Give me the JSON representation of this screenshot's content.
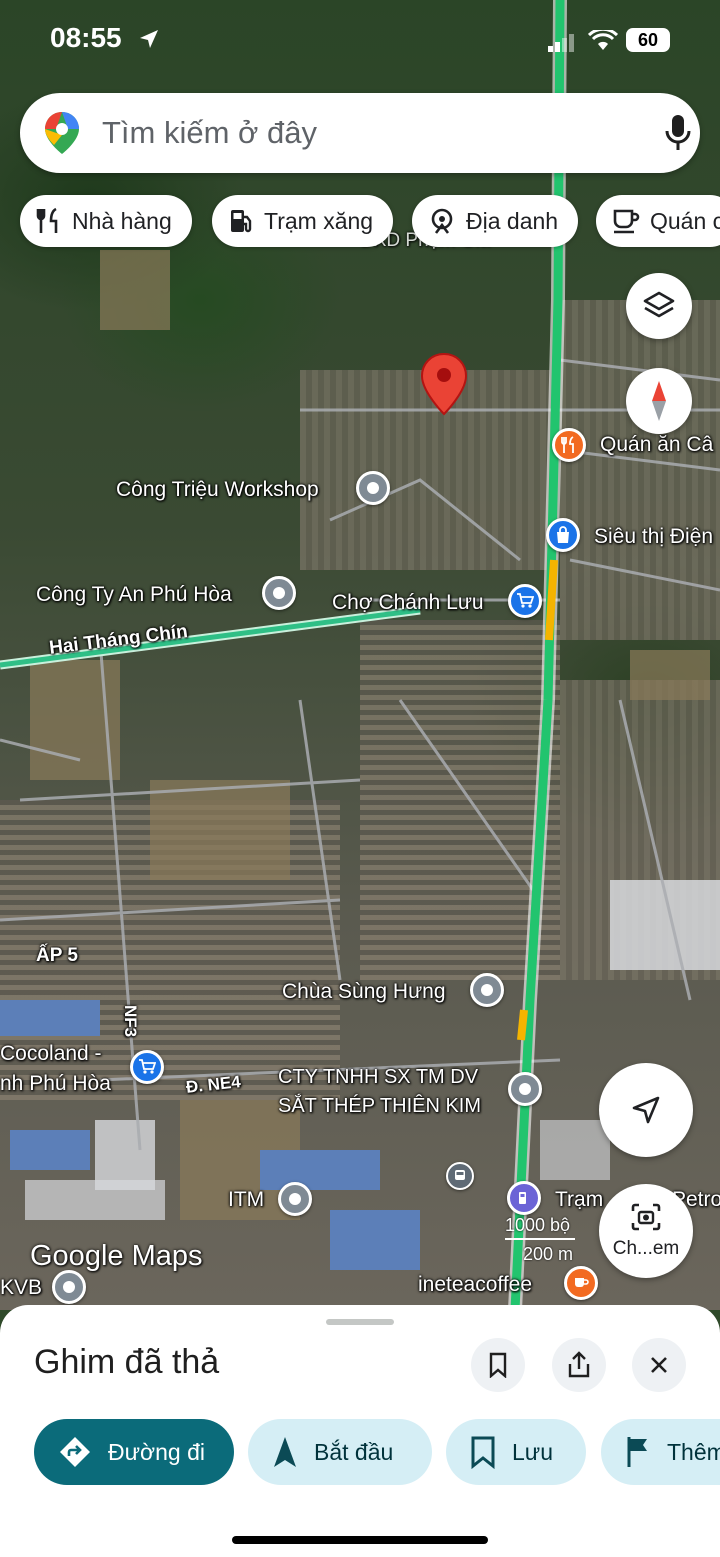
{
  "status": {
    "time": "08:55",
    "battery": "60"
  },
  "search": {
    "placeholder": "Tìm kiếm ở đây"
  },
  "chips": [
    {
      "label": "Nhà hàng",
      "icon": "fork-knife-icon"
    },
    {
      "label": "Trạm xăng",
      "icon": "gas-station-icon"
    },
    {
      "label": "Địa danh",
      "icon": "landmark-icon"
    },
    {
      "label": "Quán c",
      "icon": "coffee-icon"
    }
  ],
  "map": {
    "places": {
      "quan_an": "Quán ăn Câ",
      "sieu_thi": "Siêu thị Điện",
      "cong_trieu": "Công Triệu Workshop",
      "an_phu_hoa": "Công Ty An Phú Hòa",
      "cho_chanh_luu": "Chợ Chánh Lưu",
      "chua": "Chùa Sùng Hưng",
      "cocoland_1": "Cocoland -",
      "cocoland_2": "nh Phú Hòa",
      "thien_kim_1": "CTY TNHH SX TM DV",
      "thien_kim_2": "SẮT THÉP THIÊN KIM",
      "itm": "ITM",
      "tram": "Trạm",
      "petro": "Petro",
      "ineteacoffee": "ineteacoffee",
      "kvb": "KVB",
      "dxd": "DXD Phạm Gia"
    },
    "roads": {
      "hai_thang_chin": "Hai Tháng Chín",
      "ap5": "ẤP 5",
      "nf3": "NF3",
      "ne4": "Đ. NE4"
    },
    "scale": {
      "imperial": "1000 bộ",
      "metric": "200 m"
    },
    "watermark": "Google Maps",
    "camera_label": "Ch...em"
  },
  "sheet": {
    "title": "Ghim đã thả",
    "actions": [
      {
        "label": "Đường đi",
        "icon": "directions-icon"
      },
      {
        "label": "Bắt đầu",
        "icon": "navigation-arrow-icon"
      },
      {
        "label": "Lưu",
        "icon": "bookmark-icon"
      },
      {
        "label": "Thêm",
        "icon": "flag-icon"
      }
    ]
  },
  "colors": {
    "accent": "#0b6b7a",
    "chip_light": "#d5eef5",
    "pin_red": "#ea4335",
    "route_green": "#22c46e"
  }
}
